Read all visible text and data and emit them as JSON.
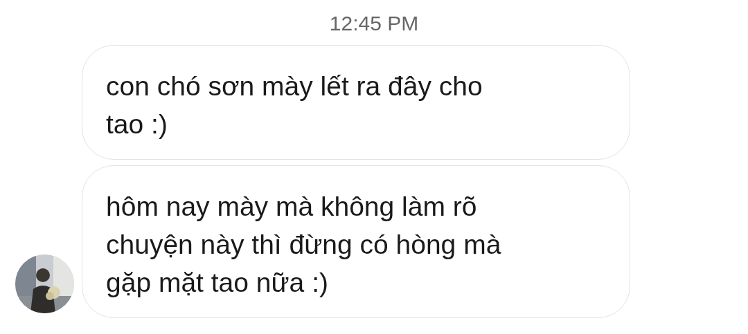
{
  "timestamp": "12:45 PM",
  "messages": [
    {
      "lines": [
        "con chó sơn mày lết ra đây cho",
        "tao :)"
      ]
    },
    {
      "lines": [
        "hôm nay mày mà không làm rõ",
        "chuyện này thì đừng có hòng mà",
        "gặp mặt tao nữa :)"
      ]
    }
  ]
}
